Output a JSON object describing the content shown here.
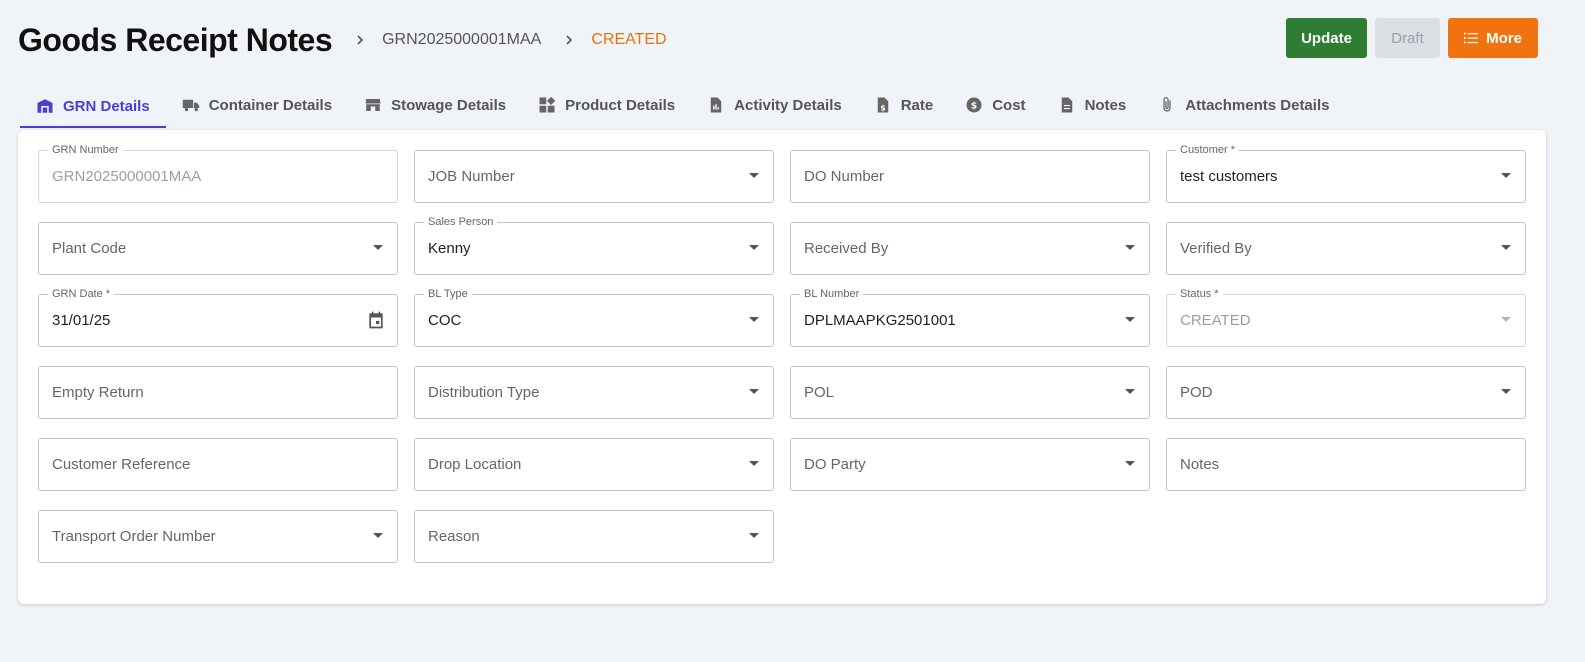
{
  "header": {
    "title": "Goods Receipt Notes",
    "grn_id": "GRN2025000001MAA",
    "status": "CREATED"
  },
  "actions": {
    "update_label": "Update",
    "draft_label": "Draft",
    "more_label": "More"
  },
  "tabs": [
    {
      "label": "GRN Details",
      "icon": "warehouse-icon",
      "active": true
    },
    {
      "label": "Container Details",
      "icon": "truck-icon"
    },
    {
      "label": "Stowage Details",
      "icon": "store-icon"
    },
    {
      "label": "Product Details",
      "icon": "widgets-icon"
    },
    {
      "label": "Activity Details",
      "icon": "file-chart-icon"
    },
    {
      "label": "Rate",
      "icon": "invoice-dollar-icon"
    },
    {
      "label": "Cost",
      "icon": "dollar-circle-icon"
    },
    {
      "label": "Notes",
      "icon": "document-icon"
    },
    {
      "label": "Attachments Details",
      "icon": "paperclip-icon"
    }
  ],
  "form": {
    "grn_number": {
      "label": "GRN Number",
      "value": "GRN2025000001MAA"
    },
    "job_number": {
      "placeholder": "JOB Number"
    },
    "do_number": {
      "placeholder": "DO Number"
    },
    "customer": {
      "label": "Customer *",
      "value": "test customers"
    },
    "plant_code": {
      "placeholder": "Plant Code"
    },
    "sales_person": {
      "label": "Sales Person",
      "value": "Kenny"
    },
    "received_by": {
      "placeholder": "Received By"
    },
    "verified_by": {
      "placeholder": "Verified By"
    },
    "grn_date": {
      "label": "GRN Date *",
      "value": "31/01/25"
    },
    "bl_type": {
      "label": "BL Type",
      "value": "COC"
    },
    "bl_number": {
      "label": "BL Number",
      "value": "DPLMAAPKG2501001"
    },
    "status": {
      "label": "Status *",
      "value": "CREATED"
    },
    "empty_return": {
      "placeholder": "Empty Return"
    },
    "distribution_type": {
      "placeholder": "Distribution Type"
    },
    "pol": {
      "placeholder": "POL"
    },
    "pod": {
      "placeholder": "POD"
    },
    "customer_reference": {
      "placeholder": "Customer Reference"
    },
    "drop_location": {
      "placeholder": "Drop Location"
    },
    "do_party": {
      "placeholder": "DO Party"
    },
    "notes": {
      "placeholder": "Notes"
    },
    "transport_order_number": {
      "placeholder": "Transport Order Number"
    },
    "reason": {
      "placeholder": "Reason"
    }
  },
  "colors": {
    "accent": "#4a3fd1",
    "update_button": "#2e7d32",
    "more_button": "#f07310",
    "status_text": "#e8720c"
  }
}
